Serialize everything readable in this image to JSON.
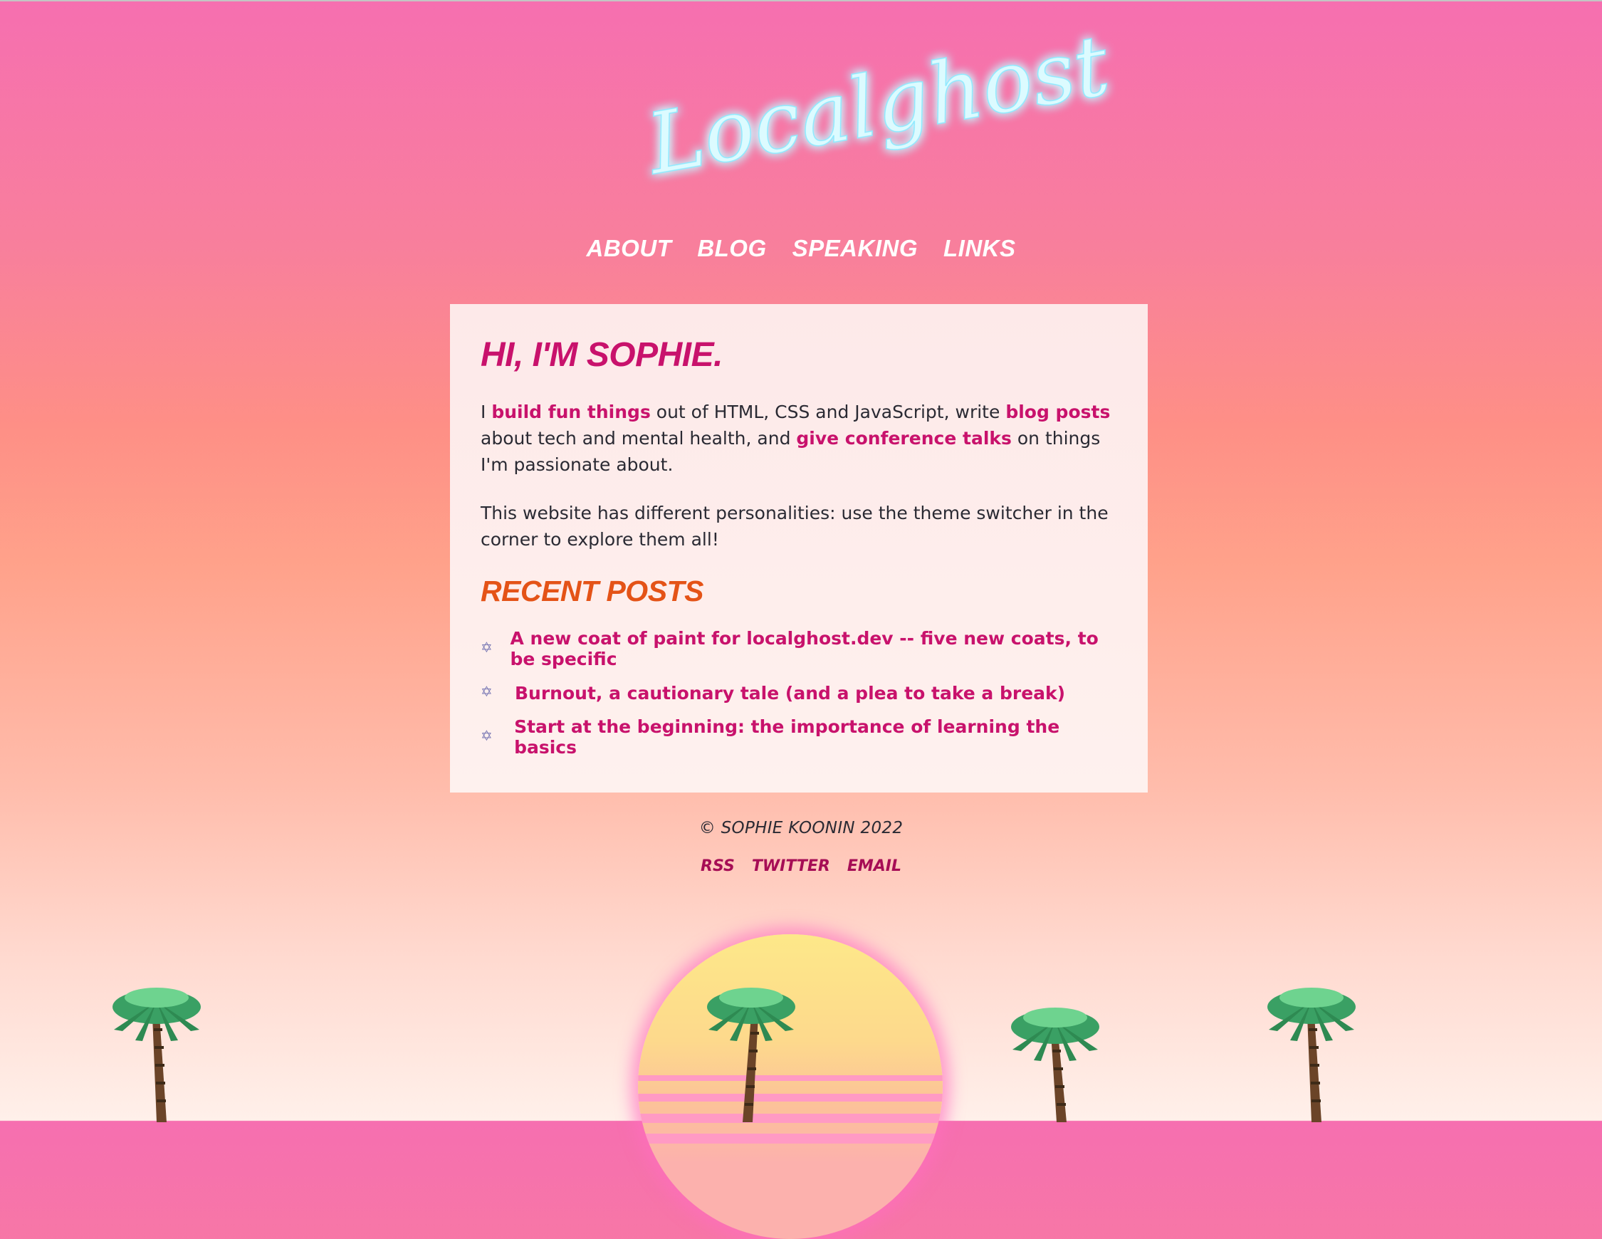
{
  "site": {
    "logo_text": "Localghost"
  },
  "nav": {
    "items": [
      {
        "label": "ABOUT"
      },
      {
        "label": "BLOG"
      },
      {
        "label": "SPEAKING"
      },
      {
        "label": "LINKS"
      }
    ]
  },
  "intro": {
    "heading": "HI, I'M SOPHIE.",
    "p1_a": "I ",
    "p1_link1": "build fun things",
    "p1_b": " out of HTML, CSS and JavaScript, write ",
    "p1_link2": "blog posts",
    "p1_c": " about tech and mental health, and ",
    "p1_link3": "give conference talks",
    "p1_d": " on things I'm passionate about.",
    "p2": "This website has different personalities: use the theme switcher in the corner to explore them all!"
  },
  "recent_posts": {
    "heading": "RECENT POSTS",
    "icon": "star-of-david-icon",
    "items": [
      {
        "title": "A new coat of paint for localghost.dev -- five new coats, to be specific"
      },
      {
        "title": "Burnout, a cautionary tale (and a plea to take a break)"
      },
      {
        "title": "Start at the beginning: the importance of learning the basics"
      }
    ]
  },
  "footer": {
    "copyright": "© SOPHIE KOONIN 2022",
    "links": [
      {
        "label": "RSS"
      },
      {
        "label": "TWITTER"
      },
      {
        "label": "EMAIL"
      }
    ]
  },
  "colors": {
    "accent_pink": "#c8126c",
    "accent_orange": "#e45317",
    "neon_blue": "#8eeaff"
  }
}
